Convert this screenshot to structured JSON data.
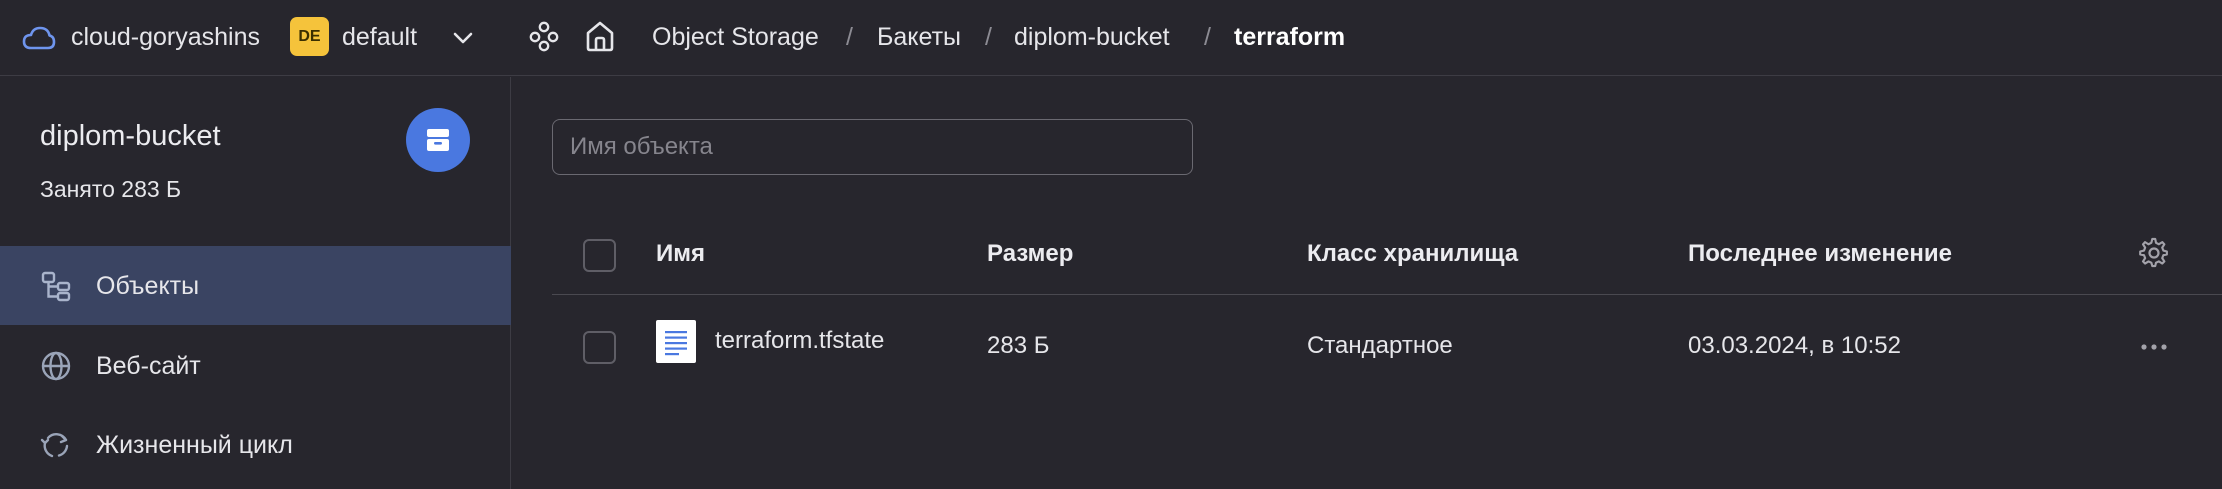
{
  "topbar": {
    "cloud_name": "cloud-goryashins",
    "folder_badge": "DE",
    "folder_name": "default",
    "breadcrumbs": [
      "Object Storage",
      "Бакеты",
      "diplom-bucket",
      "terraform"
    ],
    "separator": "/"
  },
  "sidebar": {
    "bucket_name": "diplom-bucket",
    "bucket_usage": "Занято 283 Б",
    "items": [
      {
        "label": "Объекты",
        "icon": "objects-icon",
        "active": true
      },
      {
        "label": "Веб-сайт",
        "icon": "globe-icon",
        "active": false
      },
      {
        "label": "Жизненный цикл",
        "icon": "lifecycle-icon",
        "active": false
      }
    ]
  },
  "main": {
    "search_placeholder": "Имя объекта",
    "search_value": "",
    "columns": [
      "Имя",
      "Размер",
      "Класс хранилища",
      "Последнее изменение"
    ],
    "rows": [
      {
        "name": "terraform.tfstate",
        "size": "283 Б",
        "storage_class": "Стандартное",
        "modified": "03.03.2024, в 10:52"
      }
    ]
  },
  "colors": {
    "background": "#27262d",
    "accent": "#4a78e0",
    "active_nav": "#3a4462",
    "folder_badge": "#f5c33b"
  }
}
